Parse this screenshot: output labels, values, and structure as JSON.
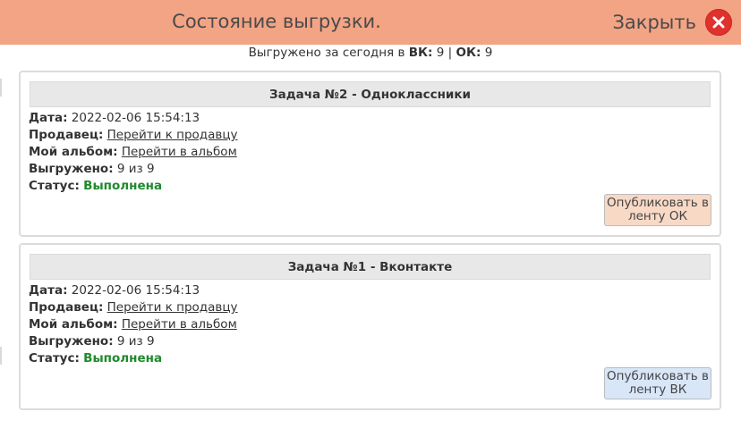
{
  "header": {
    "title": "Состояние выгрузки.",
    "close_label": "Закрыть"
  },
  "summary": {
    "prefix": "Выгружено за сегодня в",
    "vk_label": "ВК:",
    "vk_count": "9",
    "separator": "|",
    "ok_label": "ОК:",
    "ok_count": "9"
  },
  "tasks": [
    {
      "title": "Задача №2 - Одноклассники",
      "date_label": "Дата:",
      "date_value": "2022-02-06 15:54:13",
      "seller_label": "Продавец:",
      "seller_link": "Перейти к продавцу",
      "album_label": "Мой альбом:",
      "album_link": "Перейти в альбом",
      "uploaded_label": "Выгружено:",
      "uploaded_value": "9 из 9",
      "status_label": "Статус:",
      "status_value": "Выполнена",
      "publish_button": "Опубликовать в ленту ОК"
    },
    {
      "title": "Задача №1 - Вконтакте",
      "date_label": "Дата:",
      "date_value": "2022-02-06 15:54:13",
      "seller_label": "Продавец:",
      "seller_link": "Перейти к продавцу",
      "album_label": "Мой альбом:",
      "album_link": "Перейти в альбом",
      "uploaded_label": "Выгружено:",
      "uploaded_value": "9 из 9",
      "status_label": "Статус:",
      "status_value": "Выполнена",
      "publish_button": "Опубликовать в ленту ВК"
    }
  ],
  "colors": {
    "header_bg": "#f3a485",
    "close_icon": "#e0312d",
    "status_done": "#1e8a2c",
    "ok_button": "#f8d9c6",
    "vk_button": "#d8e6f8"
  }
}
